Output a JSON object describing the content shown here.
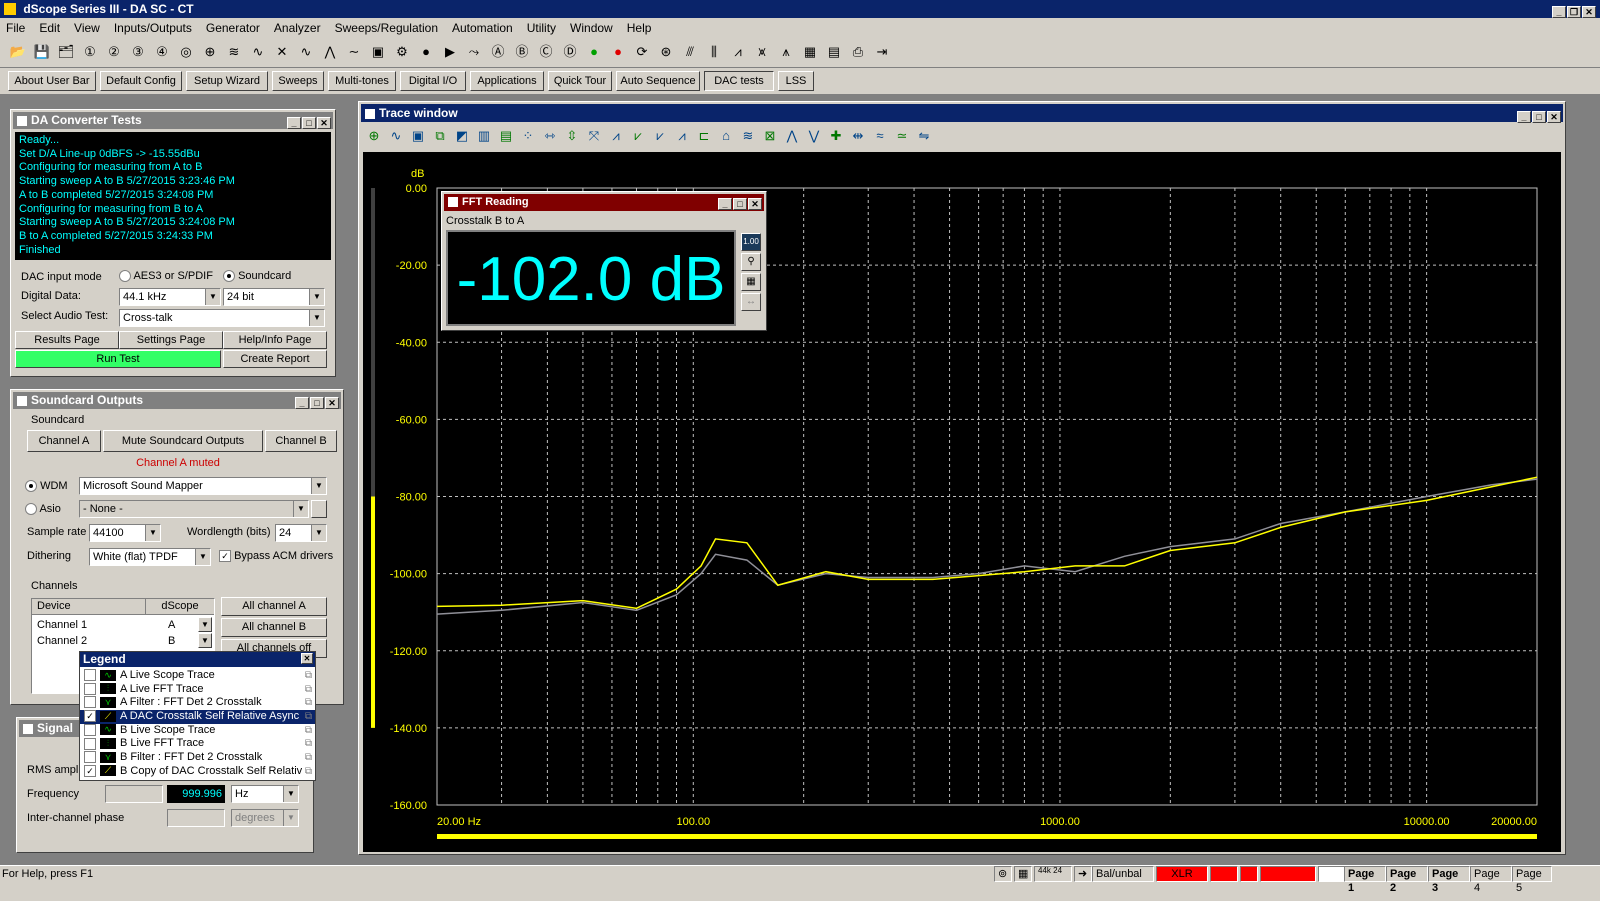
{
  "app": {
    "title": "dScope Series III - DA SC - CT"
  },
  "menu": [
    "File",
    "Edit",
    "View",
    "Inputs/Outputs",
    "Generator",
    "Analyzer",
    "Sweeps/Regulation",
    "Automation",
    "Utility",
    "Window",
    "Help"
  ],
  "toolbar_icons": [
    "open-icon",
    "save-icon",
    "save-all-icon",
    "out-1-icon",
    "out-2-icon",
    "out-3-icon",
    "out-4-icon",
    "scope-icon",
    "meter-icon",
    "fft-icon",
    "sweep-icon",
    "stop-icon",
    "wave-icon",
    "filter-icon",
    "sweep2-icon",
    "display-icon",
    "setup-icon",
    "record-icon",
    "play-icon",
    "trace-icon",
    "ch-a-icon",
    "ch-b-icon",
    "ch-c-icon",
    "ch-d-icon",
    "go-icon",
    "red-stop-icon",
    "signal-icon",
    "waveform-icon",
    "graph-a-icon",
    "graph-b-icon",
    "graph-c-icon",
    "graph-d-icon",
    "graph-e-icon",
    "report-icon",
    "export-icon",
    "print-icon",
    "exit-icon"
  ],
  "quickbar": [
    "About User Bar",
    "Default Config",
    "Setup Wizard",
    "Sweeps",
    "Multi-tones",
    "Digital I/O",
    "Applications",
    "Quick Tour",
    "Auto Sequence",
    "DAC tests",
    "LSS"
  ],
  "dac_tests": {
    "title": "DA Converter Tests",
    "log": [
      "Ready...",
      "Set D/A Line-up 0dBFS -> -15.55dBu",
      "Configuring for measuring from A to B",
      "Starting sweep A to B 5/27/2015 3:23:46 PM",
      "A to B completed 5/27/2015 3:24:08 PM",
      "Configuring for measuring from B to A",
      "Starting sweep A to B 5/27/2015 3:24:08 PM",
      "B to A completed 5/27/2015 3:24:33 PM",
      "Finished"
    ],
    "dac_input_mode_label": "DAC input mode",
    "mode_option_1": "AES3 or S/PDIF",
    "mode_option_2": "Soundcard",
    "digital_data_label": "Digital Data:",
    "sample_rate": "44.1 kHz",
    "bit_depth": "24 bit",
    "select_test_label": "Select Audio Test:",
    "selected_test": "Cross-talk",
    "results_page": "Results Page",
    "settings_page": "Settings Page",
    "help_page": "Help/Info Page",
    "run_test": "Run Test",
    "create_report": "Create Report"
  },
  "soundcard_outputs": {
    "title": "Soundcard Outputs",
    "group_label": "Soundcard",
    "tab_a": "Channel A",
    "tab_mute": "Mute Soundcard Outputs",
    "tab_b": "Channel B",
    "muted_message": "Channel A muted",
    "wdm_label": "WDM",
    "wdm_device": "Microsoft Sound Mapper",
    "asio_label": "Asio",
    "asio_device": "- None -",
    "sample_rate_label": "Sample rate",
    "sample_rate": "44100",
    "wordlength_label": "Wordlength (bits)",
    "wordlength": "24",
    "dithering_label": "Dithering",
    "dithering": "White (flat) TPDF",
    "bypass_label": "Bypass ACM drivers",
    "channels_label": "Channels",
    "col_device": "Device",
    "col_dscope": "dScope",
    "rows": [
      {
        "device": "Channel 1",
        "dscope": "A"
      },
      {
        "device": "Channel 2",
        "dscope": "B"
      }
    ],
    "all_a": "All channel A",
    "all_b": "All channel B",
    "all_off": "All channels off"
  },
  "signal_panel": {
    "title": "Signal",
    "rms_label": "RMS ampli",
    "frequency_label": "Frequency",
    "frequency_value": "999.996",
    "frequency_unit": "Hz",
    "phase_label": "Inter-channel phase",
    "phase_unit": "degrees"
  },
  "legend": {
    "title": "Legend",
    "items": [
      {
        "label": "A  Live Scope Trace",
        "checked": false,
        "icon": "scope-trace-icon"
      },
      {
        "label": "A  Live FFT Trace",
        "checked": false,
        "icon": "fft-trace-icon"
      },
      {
        "label": "A  Filter : FFT Det 2 Crosstalk",
        "checked": false,
        "icon": "filter-trace-icon"
      },
      {
        "label": "A  DAC Crosstalk Self Relative Async",
        "checked": true,
        "icon": "sweep-trace-icon"
      },
      {
        "label": "B  Live Scope Trace",
        "checked": false,
        "icon": "scope-trace-icon"
      },
      {
        "label": "B  Live FFT Trace",
        "checked": false,
        "icon": "fft-trace-icon"
      },
      {
        "label": "B  Filter : FFT Det 2 Crosstalk",
        "checked": false,
        "icon": "filter-trace-icon"
      },
      {
        "label": "B  Copy of  DAC Crosstalk Self Relativ",
        "checked": true,
        "icon": "sweep-trace-icon"
      }
    ]
  },
  "trace_window": {
    "title": "Trace window",
    "y_unit": "dB"
  },
  "fft_reading": {
    "title": "FFT Reading",
    "subtitle": "Crosstalk B to A",
    "value": "-102.0 dB"
  },
  "chart_data": {
    "type": "line",
    "title": "",
    "xlabel": "",
    "ylabel": "dB",
    "x_scale": "log",
    "xlim": [
      20,
      20000
    ],
    "ylim": [
      -160,
      0
    ],
    "y_ticks": [
      "0.00",
      "-20.00",
      "-40.00",
      "-60.00",
      "-80.00",
      "-100.00",
      "-120.00",
      "-140.00",
      "-160.00"
    ],
    "x_tick_labels": [
      {
        "value": 20,
        "label": "20.00 Hz"
      },
      {
        "value": 100,
        "label": "100.00"
      },
      {
        "value": 1000,
        "label": "1000.00"
      },
      {
        "value": 10000,
        "label": "10000.00"
      },
      {
        "value": 20000,
        "label": "20000.00"
      }
    ],
    "grid": true,
    "series": [
      {
        "color": "#ffff00",
        "points": [
          [
            20,
            -108.5
          ],
          [
            30,
            -108.2
          ],
          [
            50,
            -107
          ],
          [
            70,
            -109
          ],
          [
            90,
            -104
          ],
          [
            105,
            -98
          ],
          [
            115,
            -91
          ],
          [
            140,
            -92
          ],
          [
            170,
            -103
          ],
          [
            230,
            -99.5
          ],
          [
            300,
            -101.5
          ],
          [
            450,
            -101.5
          ],
          [
            600,
            -100.5
          ],
          [
            800,
            -99.5
          ],
          [
            1100,
            -98
          ],
          [
            1500,
            -98
          ],
          [
            2000,
            -94
          ],
          [
            3000,
            -92
          ],
          [
            4000,
            -88
          ],
          [
            6000,
            -84
          ],
          [
            10000,
            -81
          ],
          [
            15000,
            -77.5
          ],
          [
            20000,
            -75
          ]
        ]
      },
      {
        "color": "#909098",
        "points": [
          [
            20,
            -110.5
          ],
          [
            30,
            -109.5
          ],
          [
            50,
            -107.5
          ],
          [
            70,
            -109.5
          ],
          [
            90,
            -105.5
          ],
          [
            105,
            -100
          ],
          [
            115,
            -95
          ],
          [
            140,
            -96.5
          ],
          [
            170,
            -103
          ],
          [
            230,
            -100
          ],
          [
            300,
            -101
          ],
          [
            450,
            -101
          ],
          [
            600,
            -100
          ],
          [
            800,
            -98
          ],
          [
            1100,
            -99.5
          ],
          [
            1500,
            -95.5
          ],
          [
            2000,
            -93
          ],
          [
            3000,
            -91
          ],
          [
            4000,
            -87
          ],
          [
            6000,
            -84
          ],
          [
            10000,
            -80
          ],
          [
            15000,
            -77
          ],
          [
            20000,
            -75.5
          ]
        ]
      }
    ]
  },
  "status": {
    "help_text": "For Help, press F1",
    "rate": "44k 24",
    "bal": "Bal/unbal",
    "xlr": "XLR",
    "pages": [
      "Page 1",
      "Page 2",
      "Page 3",
      "Page 4",
      "Page 5"
    ]
  },
  "colors": {
    "accent_cyan": "#00ffff",
    "trace_yellow": "#ffff00",
    "run_green": "#33ff66",
    "muted_red": "#cc0000"
  }
}
